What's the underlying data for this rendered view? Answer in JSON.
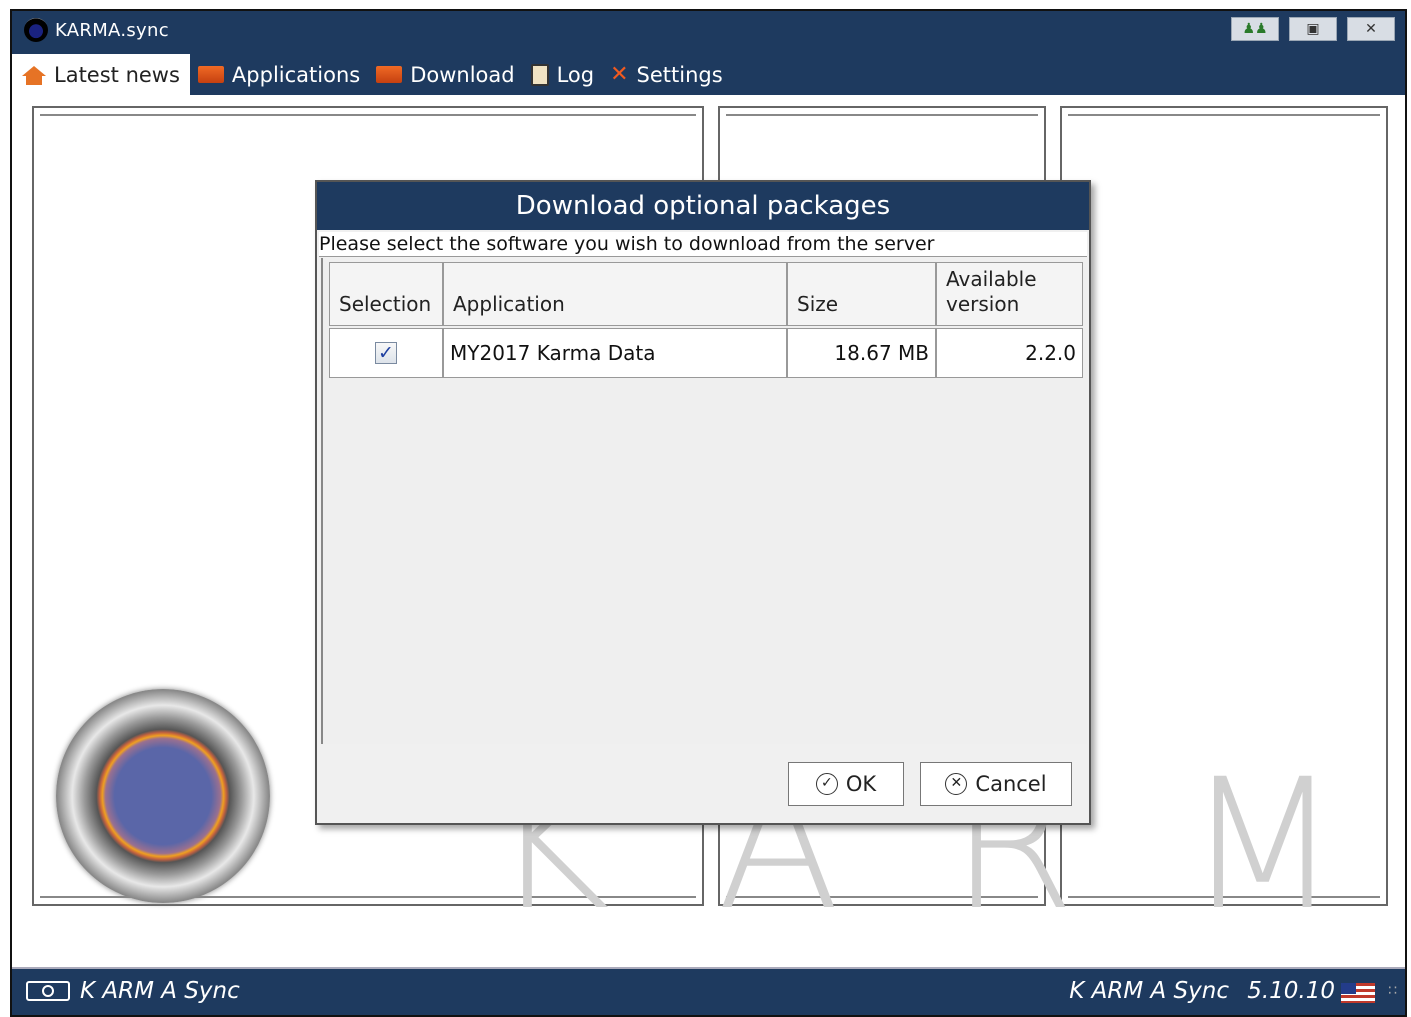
{
  "window": {
    "title": "KARMA.sync",
    "controls": [
      "users-icon",
      "restore-icon",
      "close-icon"
    ]
  },
  "nav": {
    "tabs": [
      {
        "label": "Latest news",
        "icon": "home-icon",
        "active": true
      },
      {
        "label": "Applications",
        "icon": "folder-icon",
        "active": false
      },
      {
        "label": "Download",
        "icon": "folder-icon",
        "active": false
      },
      {
        "label": "Log",
        "icon": "clipboard-icon",
        "active": false
      },
      {
        "label": "Settings",
        "icon": "tools-icon",
        "active": false
      }
    ]
  },
  "background": {
    "brand_text": "KARMA"
  },
  "dialog": {
    "title": "Download optional packages",
    "subtitle": "Please select the software you wish to download from the server",
    "columns": [
      "Selection",
      "Application",
      "Size",
      "Available version"
    ],
    "rows": [
      {
        "selected": true,
        "application": "MY2017 Karma Data",
        "size": "18.67 MB",
        "version": "2.2.0"
      }
    ],
    "ok_label": "OK",
    "cancel_label": "Cancel"
  },
  "statusbar": {
    "left_label": "K ARM A Sync",
    "right_label": "K ARM A Sync",
    "version": "5.10.10",
    "flag": "us-flag-icon"
  },
  "colors": {
    "header_bg": "#1e3a5f",
    "accent_orange": "#e67325"
  }
}
